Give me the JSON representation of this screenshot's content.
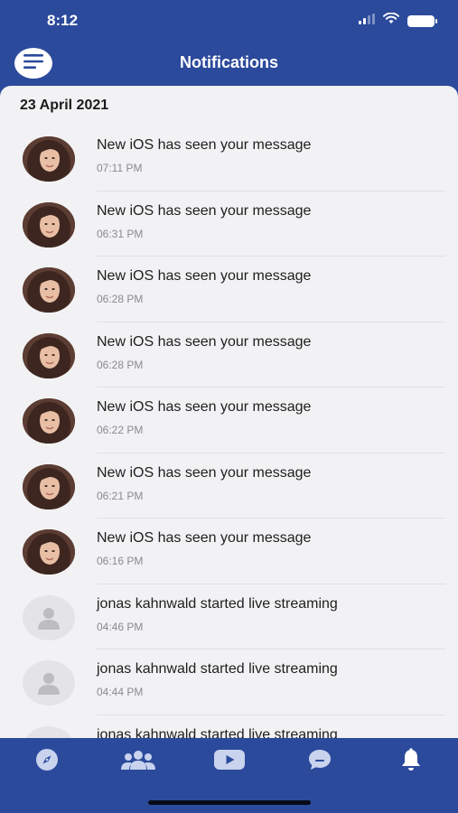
{
  "status": {
    "time": "8:12"
  },
  "header": {
    "title": "Notifications"
  },
  "section": {
    "date": "23 April 2021"
  },
  "notifications": [
    {
      "text": "New iOS has seen your message",
      "time": "07:11 PM",
      "avatar": "photo"
    },
    {
      "text": "New iOS has seen your message",
      "time": "06:31 PM",
      "avatar": "photo"
    },
    {
      "text": "New iOS has seen your message",
      "time": "06:28 PM",
      "avatar": "photo"
    },
    {
      "text": "New iOS has seen your message",
      "time": "06:28 PM",
      "avatar": "photo"
    },
    {
      "text": "New iOS has seen your message",
      "time": "06:22 PM",
      "avatar": "photo"
    },
    {
      "text": "New iOS has seen your message",
      "time": "06:21 PM",
      "avatar": "photo"
    },
    {
      "text": "New iOS has seen your message",
      "time": "06:16 PM",
      "avatar": "photo"
    },
    {
      "text": "jonas kahnwald started live streaming",
      "time": "04:46 PM",
      "avatar": "placeholder"
    },
    {
      "text": "jonas kahnwald started live streaming",
      "time": "04:44 PM",
      "avatar": "placeholder"
    },
    {
      "text": "jonas kahnwald started live streaming",
      "time": "",
      "avatar": "placeholder"
    }
  ],
  "tabs": [
    {
      "icon": "compass-icon",
      "active": false
    },
    {
      "icon": "group-icon",
      "active": false
    },
    {
      "icon": "youtube-icon",
      "active": false
    },
    {
      "icon": "chat-icon",
      "active": false
    },
    {
      "icon": "bell-icon",
      "active": true
    }
  ],
  "colors": {
    "brand": "#2c4a9c",
    "background": "#f2f2f4",
    "inactive_icon": "#c9d3ee",
    "active_icon": "#ffffff"
  }
}
